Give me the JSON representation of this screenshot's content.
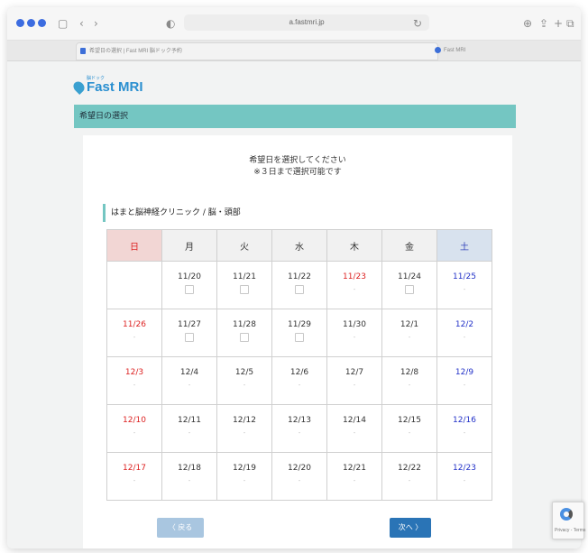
{
  "browser": {
    "address": "a.fastmri.jp",
    "tab_active_title": "希望日の選択 | Fast MRI 脳ドック予約",
    "tab_second_title": "Fast MRI",
    "back_icon": "chevron-left-icon",
    "forward_icon": "chevron-right-icon"
  },
  "logo": {
    "text": "Fast MRI",
    "subtext": "脳ドック"
  },
  "section_title": "希望日の選択",
  "instructions": {
    "line1": "希望日を選択してください",
    "line2": "※３日まで選択可能です"
  },
  "clinic_label": "はまと脳神経クリニック / 脳・頭部",
  "calendar": {
    "weekdays": [
      "日",
      "月",
      "火",
      "水",
      "木",
      "金",
      "土"
    ],
    "rows": [
      [
        "",
        "11/20",
        "11/21",
        "11/22",
        "11/23",
        "11/24",
        "11/25"
      ],
      [
        "11/26",
        "11/27",
        "11/28",
        "11/29",
        "11/30",
        "12/1",
        "12/2"
      ],
      [
        "12/3",
        "12/4",
        "12/5",
        "12/6",
        "12/7",
        "12/8",
        "12/9"
      ],
      [
        "12/10",
        "12/11",
        "12/12",
        "12/13",
        "12/14",
        "12/15",
        "12/16"
      ],
      [
        "12/17",
        "12/18",
        "12/19",
        "12/20",
        "12/21",
        "12/22",
        "12/23"
      ]
    ],
    "slot_marker": "-",
    "colors": {
      "sunday": "#dd2222",
      "saturday": "#2231c8",
      "holiday": "#dd2222"
    }
  },
  "buttons": {
    "back": "〈 戻る",
    "next": "次へ 〉"
  },
  "recaptcha_label": "Privacy - Terms",
  "colors": {
    "accent_teal": "#74c6c2",
    "brand_blue": "#2a8fd0",
    "next_button": "#2a74b6",
    "back_button": "#a9c6e0"
  }
}
